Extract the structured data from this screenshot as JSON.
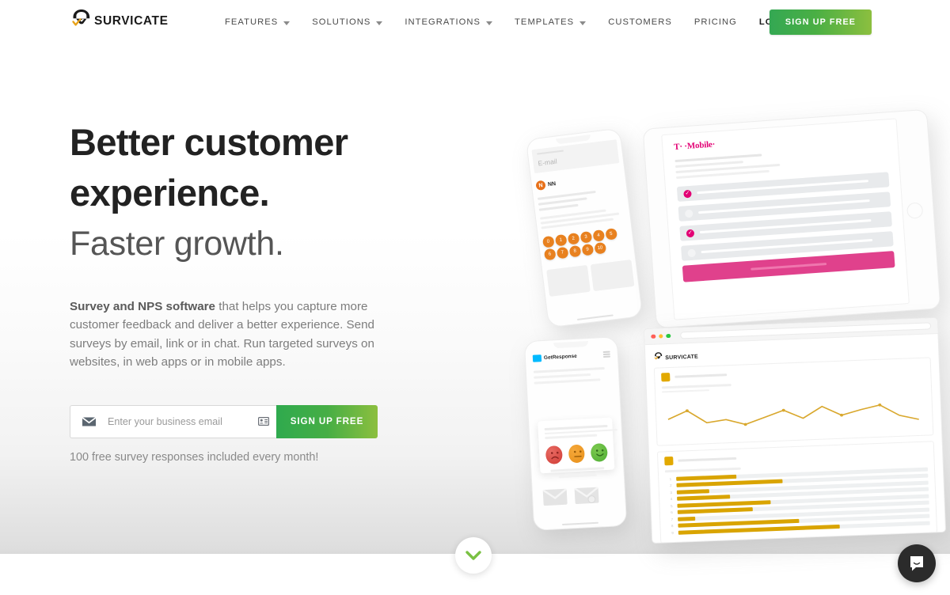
{
  "brand": {
    "name": "SURVICATE",
    "logo_icon": "survicate-headset-check-logo",
    "accent_green_start": "#2faa4e",
    "accent_green_end": "#8cbf3f",
    "accent_orange": "#e8811f",
    "accent_gold": "#d9a400"
  },
  "header": {
    "nav": [
      {
        "label": "FEATURES",
        "has_dropdown": true
      },
      {
        "label": "SOLUTIONS",
        "has_dropdown": true
      },
      {
        "label": "INTEGRATIONS",
        "has_dropdown": true
      },
      {
        "label": "TEMPLATES",
        "has_dropdown": true
      },
      {
        "label": "CUSTOMERS",
        "has_dropdown": false
      },
      {
        "label": "PRICING",
        "has_dropdown": false
      },
      {
        "label": "LOG IN",
        "has_dropdown": false
      }
    ],
    "signup_label": "SIGN UP FREE"
  },
  "hero": {
    "headline_bold": "Better customer experience.",
    "headline_light": "Faster growth.",
    "paragraph_lead": "Survey and NPS software",
    "paragraph_rest": " that helps you capture more customer feedback and deliver a better experience. Send surveys by email, link or in chat. Run targeted surveys on websites, in web apps or in mobile apps.",
    "email_placeholder": "Enter your business email",
    "email_value": "",
    "submit_label": "SIGN UP FREE",
    "form_note": "100 free survey responses included every month!",
    "email_icon": "envelope-icon",
    "autofill_icon": "contact-card-icon"
  },
  "illustration": {
    "phone_email": {
      "screen_title": "E-mail",
      "sender_logo_text": "NN",
      "nps_scores": [
        "0",
        "1",
        "2",
        "3",
        "4",
        "5",
        "6",
        "7",
        "8",
        "9",
        "10"
      ]
    },
    "tablet_survey": {
      "brand": "T· ·Mobile·",
      "options_selected": [
        true,
        false,
        true,
        false
      ],
      "cta_color": "#e0418c"
    },
    "phone_smiley": {
      "brand": "GetResponse",
      "ratings": [
        "sad-face-icon",
        "neutral-face-icon",
        "happy-face-icon"
      ]
    },
    "dashboard": {
      "brand": "SURVICATE",
      "line_chart": {
        "points": [
          58,
          44,
          30,
          52,
          68,
          55,
          62,
          78,
          66,
          86,
          60,
          72,
          88,
          80
        ]
      },
      "bar_rows": [
        {
          "label": "1",
          "value": 24
        },
        {
          "label": "2",
          "value": 42
        },
        {
          "label": "3",
          "value": 13
        },
        {
          "label": "4",
          "value": 21
        },
        {
          "label": "5",
          "value": 37
        },
        {
          "label": "6",
          "value": 30
        },
        {
          "label": "7",
          "value": 7
        },
        {
          "label": "8",
          "value": 48
        },
        {
          "label": "9",
          "value": 64
        }
      ]
    }
  },
  "scroll_button": {
    "icon": "chevron-down-icon"
  },
  "chat_launcher": {
    "icon": "chat-bubble-icon"
  }
}
